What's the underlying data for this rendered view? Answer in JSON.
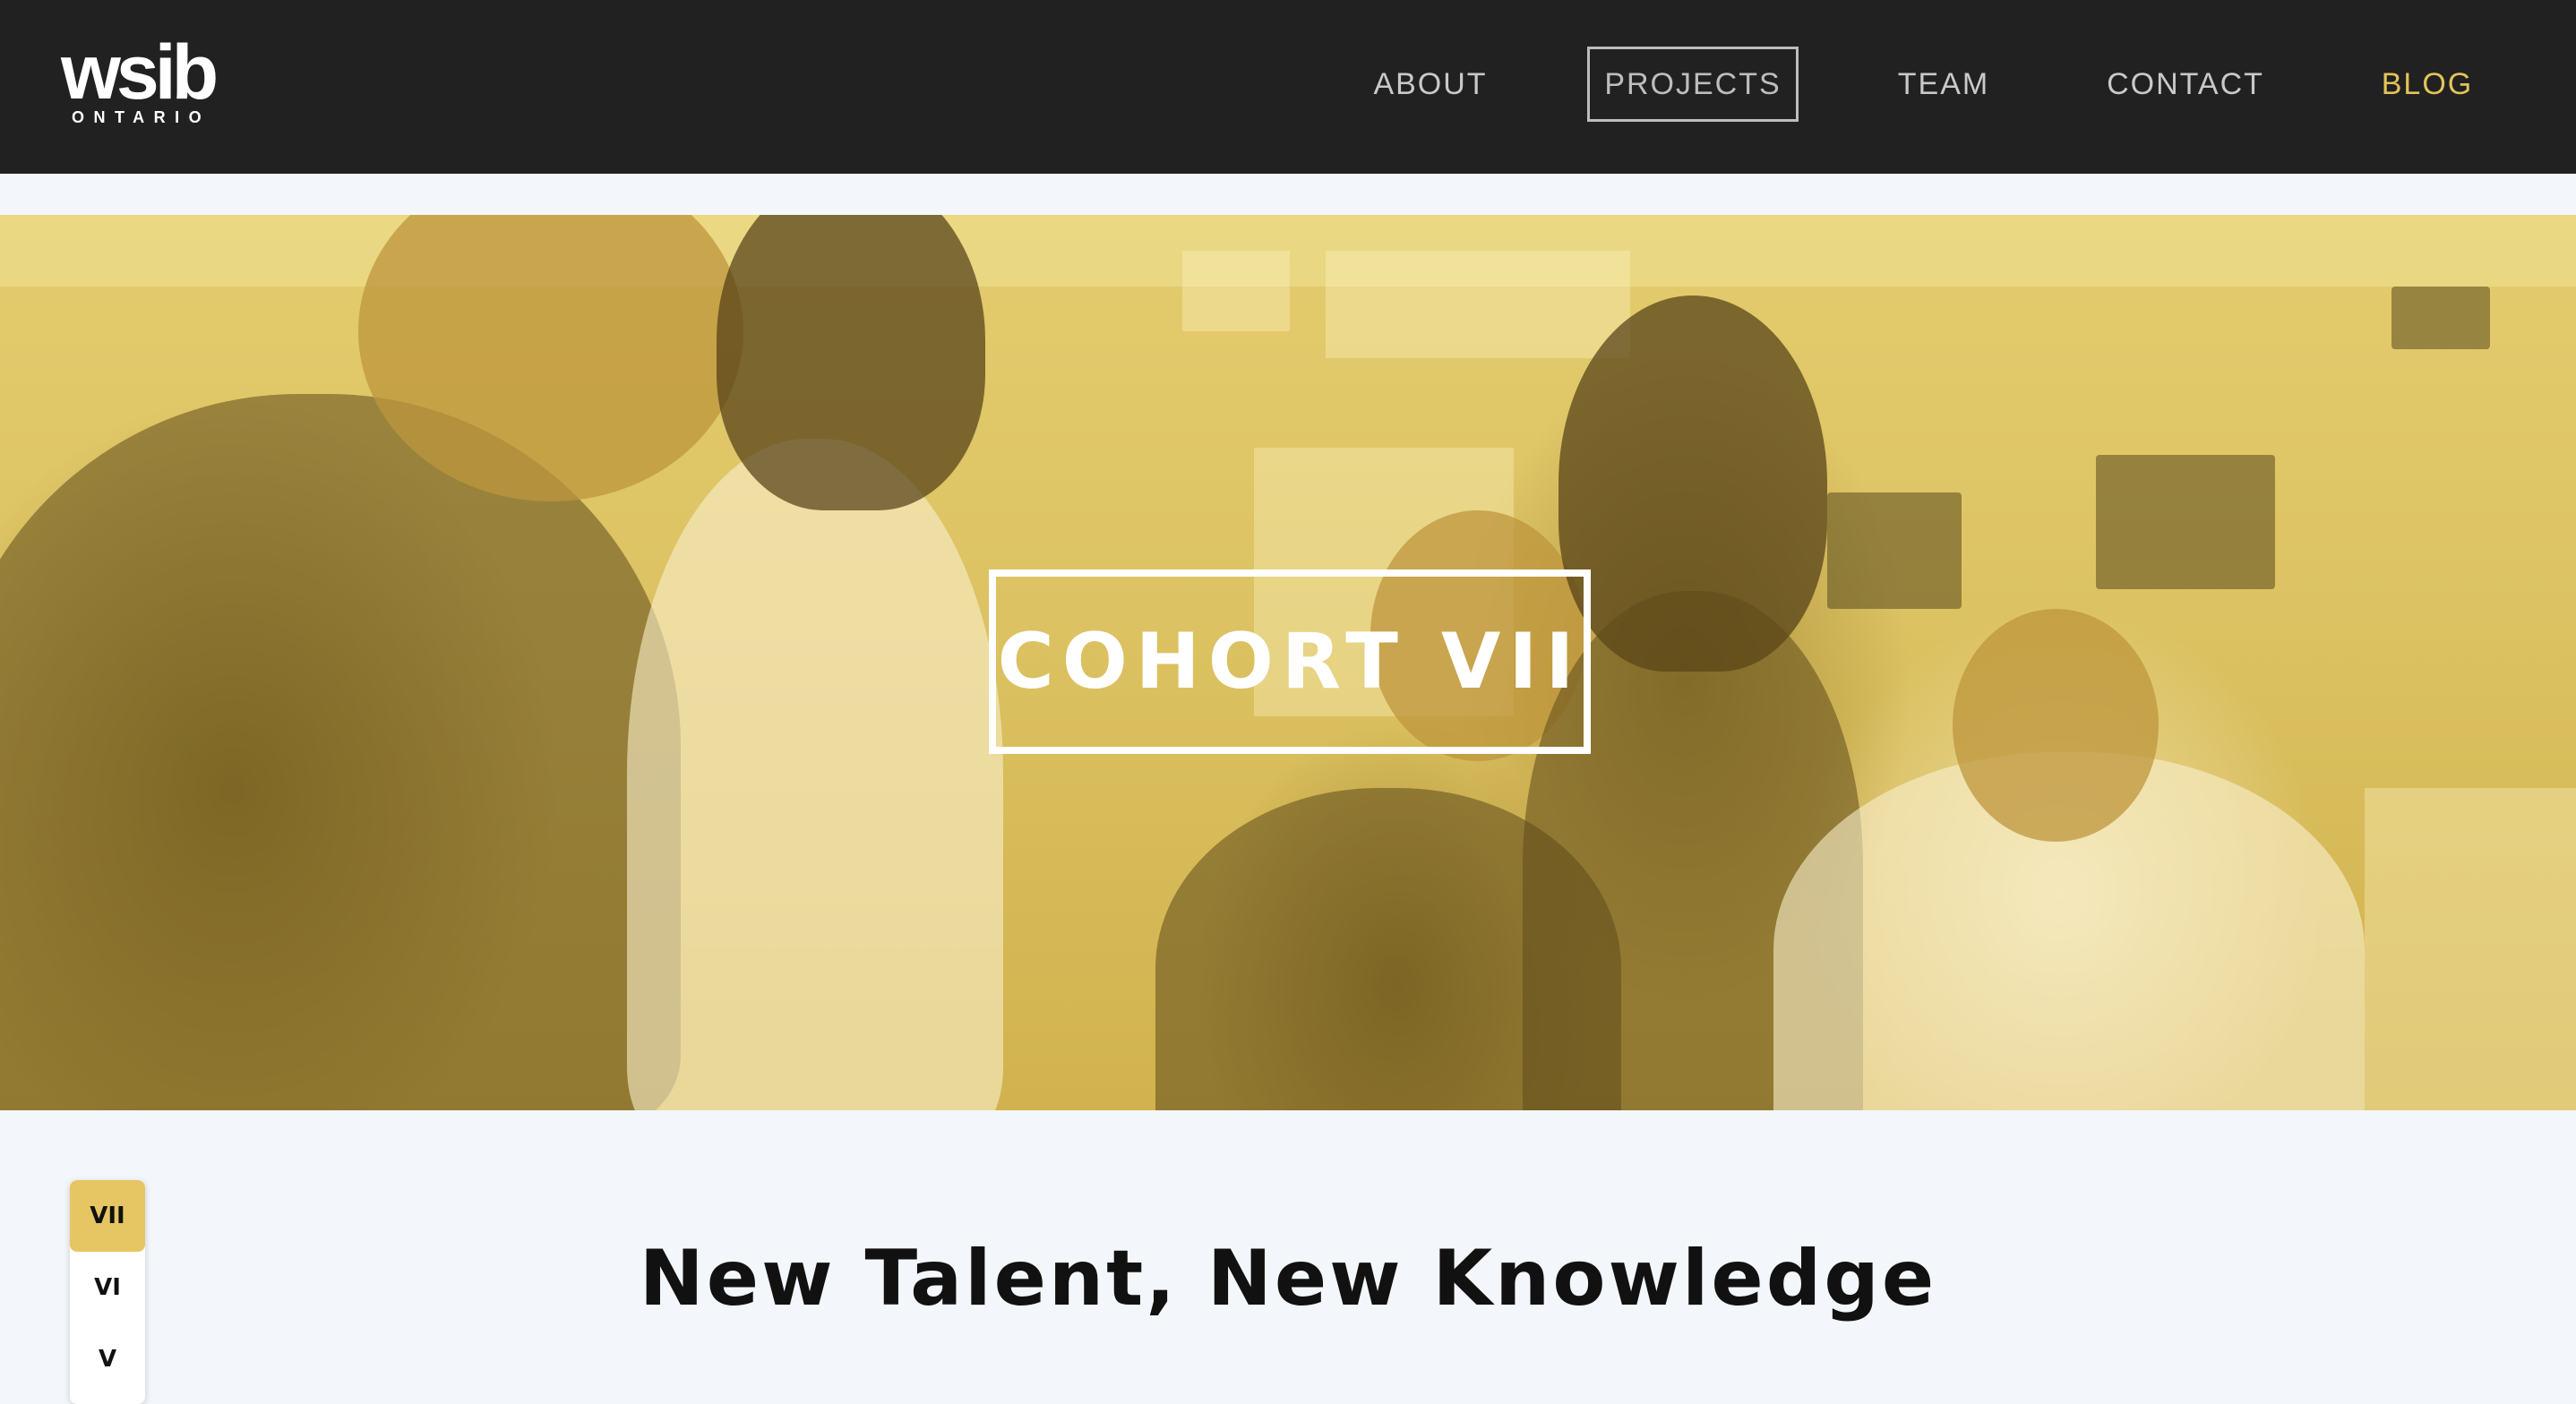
{
  "header": {
    "logo": {
      "word": "wsib",
      "sub": "ONTARIO"
    },
    "nav": [
      {
        "label": "ABOUT"
      },
      {
        "label": "PROJECTS",
        "state": "selected"
      },
      {
        "label": "TEAM"
      },
      {
        "label": "CONTACT"
      },
      {
        "label": "BLOG",
        "color": "#e3c35a"
      }
    ]
  },
  "hero": {
    "title": "COHORT VII",
    "overlay_color": "#e3c35a"
  },
  "cohort_selector": {
    "items": [
      {
        "label": "VII",
        "state": "active"
      },
      {
        "label": "VI"
      },
      {
        "label": "V"
      }
    ]
  },
  "main": {
    "heading": "New Talent, New Knowledge"
  },
  "colors": {
    "header_bg": "#212121",
    "page_bg": "#f3f7fb",
    "accent": "#e6c662"
  }
}
